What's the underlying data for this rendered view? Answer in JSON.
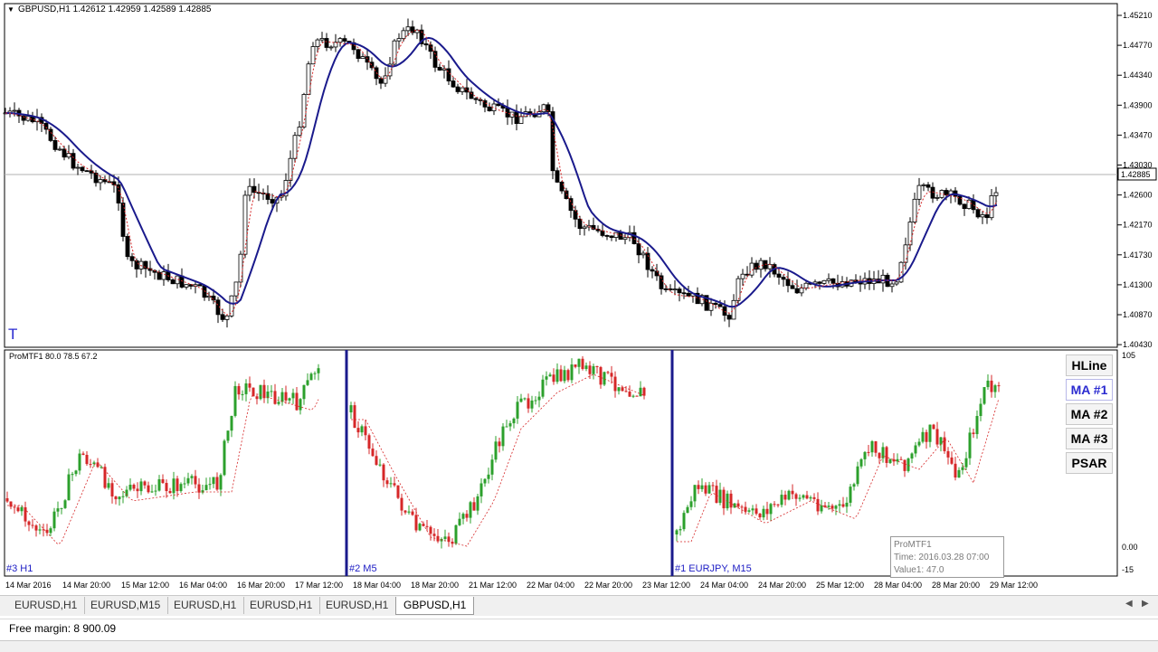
{
  "chart": {
    "symbol_line": "GBPUSD,H1  1.42612 1.42959 1.42589 1.42885",
    "t_mark": "T",
    "current_price": "1.42885",
    "price_levels": [
      "1.45210",
      "1.44770",
      "1.44340",
      "1.43900",
      "1.43470",
      "1.43030",
      "1.42600",
      "1.42170",
      "1.41730",
      "1.41300",
      "1.40870",
      "1.40430"
    ],
    "price_min": 1.4043,
    "price_max": 1.4521,
    "colors": {
      "bull": "#2ca02c",
      "bear": "#d62728",
      "ma_main": "#1a1a8c",
      "ma_fast": "#d62728",
      "grid": "#b0b0b0",
      "pane_divider": "#1a1a8c"
    }
  },
  "indicator": {
    "header": "ProMTF1 80.0 78.5 67.2",
    "scale": {
      "top": "105",
      "zero": "0.00",
      "bottom": "-15"
    },
    "pane_labels": [
      "#3 H1",
      "#2 M5",
      "#1 EURJPY, M15"
    ],
    "buttons": [
      "HLine",
      "MA #1",
      "MA #2",
      "MA #3",
      "PSAR"
    ],
    "active_button": "MA #1"
  },
  "tooltip": {
    "name": "ProMTF1",
    "time": "Time: 2016.03.28 07:00",
    "value": "Value1: 47.0"
  },
  "time_axis": [
    "14 Mar 2016",
    "14 Mar 20:00",
    "15 Mar 12:00",
    "16 Mar 04:00",
    "16 Mar 20:00",
    "17 Mar 12:00",
    "18 Mar 04:00",
    "18 Mar 20:00",
    "21 Mar 12:00",
    "22 Mar 04:00",
    "22 Mar 20:00",
    "23 Mar 12:00",
    "24 Mar 04:00",
    "24 Mar 20:00",
    "25 Mar 12:00",
    "28 Mar 04:00",
    "28 Mar 20:00",
    "29 Mar 12:00"
  ],
  "tabs": [
    "EURUSD,H1",
    "EURUSD,M15",
    "EURUSD,H1",
    "EURUSD,H1",
    "EURUSD,H1",
    "GBPUSD,H1"
  ],
  "active_tab": "GBPUSD,H1",
  "status": {
    "free_margin": "Free margin: 8 900.09"
  }
}
